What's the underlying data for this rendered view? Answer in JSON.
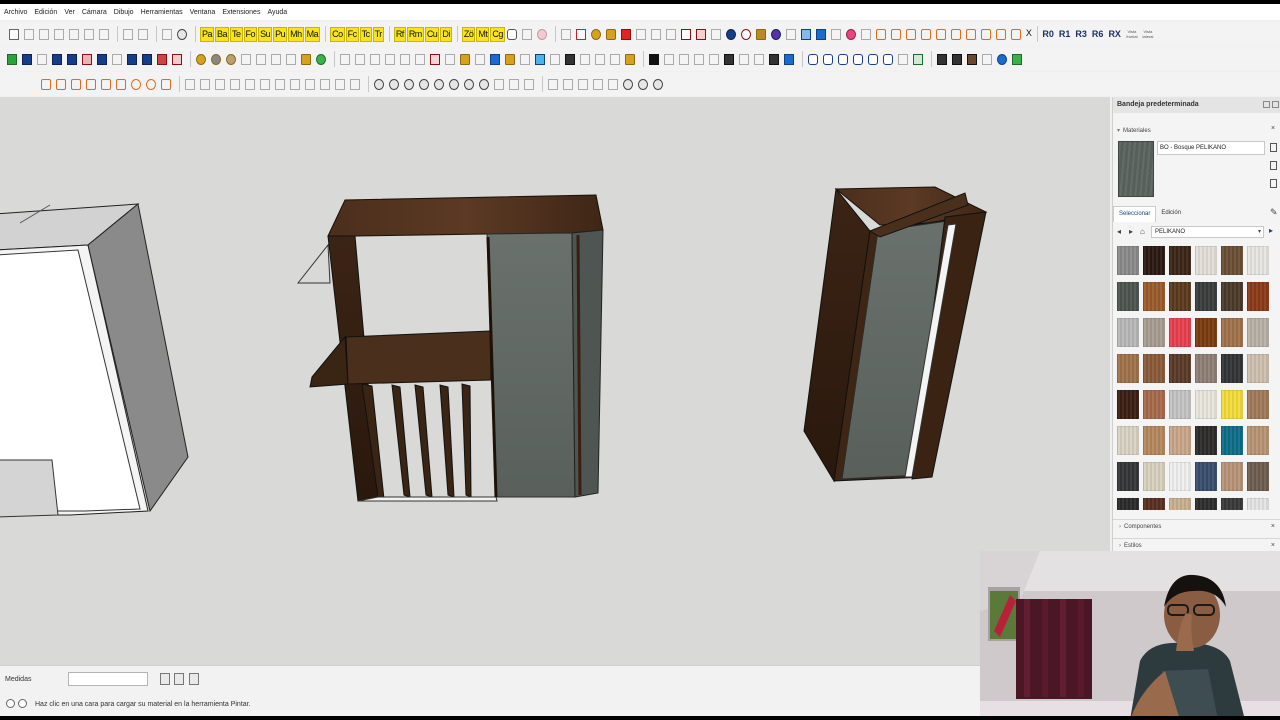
{
  "menu": [
    "Archivo",
    "Edición",
    "Ver",
    "Cámara",
    "Dibujo",
    "Herramientas",
    "Ventana",
    "Extensiones",
    "Ayuda"
  ],
  "toolbar1": {
    "yellow_tools": [
      "Pa",
      "Ba",
      "Te",
      "Fo",
      "Su",
      "Pu",
      "Mh",
      "Ma",
      "Co",
      "Fc",
      "Tc",
      "Tr",
      "Rf",
      "Rm",
      "Cu",
      "Di",
      "Zö",
      "Mt",
      "Cg"
    ],
    "rotate_tools": [
      "R0",
      "R1",
      "R3",
      "R6",
      "RX"
    ],
    "tiny_labels": [
      "Vista\nfrontal",
      "Vista\nlateral"
    ],
    "close_glyph": "X"
  },
  "viewport": {
    "background": "#d9d9d7"
  },
  "statusbar": {
    "medidas_label": "Medidas",
    "hint": "Haz clic en una cara para cargar su material en la herramienta Pintar."
  },
  "tray": {
    "title": "Bandeja predeterminada",
    "materials": {
      "header": "Materiales",
      "current_material": "BO - Bosque PELIKANO",
      "tabs": [
        "Seleccionar",
        "Edición"
      ],
      "library": "PELIKANO",
      "swatches": [
        "#8a8a8a",
        "#2a1a12",
        "#3b2518",
        "#e2ddd6",
        "#6b4f35",
        "#e8e6e2",
        "#4e5550",
        "#9b5a2a",
        "#5a3a1e",
        "#3a3b3b",
        "#4a3a2c",
        "#8c3a17",
        "#b8b8b8",
        "#a89c91",
        "#e8404f",
        "#7b3b10",
        "#a0724a",
        "#b8b0a6",
        "#a0724a",
        "#8a5a38",
        "#5a3a28",
        "#8e8075",
        "#333436",
        "#cdbfae",
        "#3b1f14",
        "#a86a4b",
        "#c4c4c4",
        "#e9e5dc",
        "#f2dc3c",
        "#a07a58",
        "#d9d2c3",
        "#b6875e",
        "#c9a689",
        "#2e2b2a",
        "#0d6f89",
        "#b89574",
        "#353637",
        "#d8d0bd",
        "#efefef",
        "#384c6c",
        "#b89478",
        "#6f5e50",
        "#2a2a2a",
        "#5a3020",
        "#c8b08f",
        "#2e2e2e",
        "#393939",
        "#e3e3e3"
      ]
    },
    "sections": [
      "Componentes",
      "Estilos"
    ],
    "close_glyph": "×"
  }
}
